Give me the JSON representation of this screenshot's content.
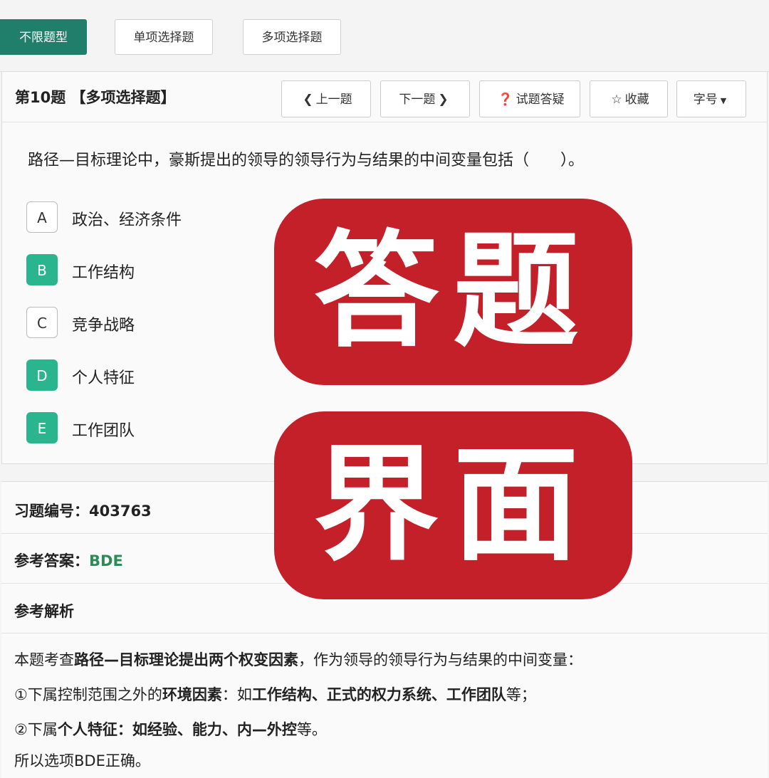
{
  "question_types": {
    "active": "不限题型",
    "single": "单项选择题",
    "multiple": "多项选择题"
  },
  "question": {
    "number_label": "第10题",
    "type_label": "【多项选择题】",
    "text": "路径—目标理论中，豪斯提出的领导的领导行为与结果的中间变量包括（　　）。",
    "options": [
      {
        "letter": "A",
        "text": "政治、经济条件",
        "selected": false
      },
      {
        "letter": "B",
        "text": "工作结构",
        "selected": true
      },
      {
        "letter": "C",
        "text": "竞争战略",
        "selected": false
      },
      {
        "letter": "D",
        "text": "个人特征",
        "selected": true
      },
      {
        "letter": "E",
        "text": "工作团队",
        "selected": true
      }
    ]
  },
  "toolbar": {
    "prev": "上一题",
    "next": "下一题",
    "qa": "试题答疑",
    "favorite": "收藏",
    "font": "字号"
  },
  "answer": {
    "id_label": "习题编号：",
    "id_value": "403763",
    "ref_label": "参考答案：",
    "ref_value": "BDE",
    "analysis_label": "参考解析"
  },
  "analysis": {
    "line1": {
      "a": "本题考查",
      "b": "路径—目标理论提出两个权变因素",
      "c": "，作为领导的领导行为与结果的中间变量："
    },
    "line2": {
      "a": "①下属控制范围之外的",
      "b": "环境因素",
      "c": "：如",
      "d": "工作结构、正式的权力系统、工作团队",
      "e": "等；"
    },
    "line3": {
      "a": "②下属",
      "b": "个人特征：如经验、能力、内—外控",
      "c": "等。"
    },
    "line4": "所以选项BDE正确。"
  },
  "overlay": {
    "top": "答题",
    "bottom": "界面"
  },
  "colors": {
    "accent": "#1f7f6b",
    "selected": "#2bb58f",
    "answer": "#2e8b57",
    "overlay": "#c4202a"
  }
}
